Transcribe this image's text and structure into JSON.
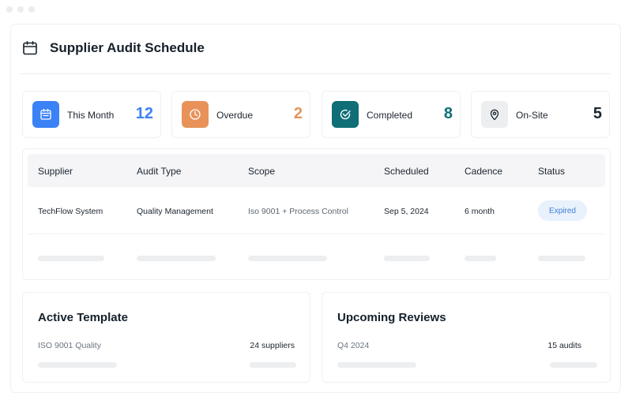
{
  "page": {
    "title": "Supplier Audit Schedule"
  },
  "stats": [
    {
      "label": "This Month",
      "value": "12",
      "color": "#3b82f6",
      "icon": "calendar-icon"
    },
    {
      "label": "Overdue",
      "value": "2",
      "color": "#e8925a",
      "icon": "clock-icon"
    },
    {
      "label": "Completed",
      "value": "8",
      "color": "#0f6e76",
      "icon": "check-circle-icon"
    },
    {
      "label": "On-Site",
      "value": "5",
      "color": "#1b2530",
      "icon": "map-pin-icon"
    }
  ],
  "table": {
    "columns": [
      "Supplier",
      "Audit Type",
      "Scope",
      "Scheduled",
      "Cadence",
      "Status"
    ],
    "rows": [
      {
        "supplier": "TechFlow System",
        "audit_type": "Quality Management",
        "scope": "Iso 9001 + Process Control",
        "scheduled": "Sep 5, 2024",
        "cadence": "6 month",
        "status": "Expired"
      }
    ]
  },
  "active_template": {
    "title": "Active Template",
    "name": "ISO 9001 Quality",
    "count": "24 suppliers"
  },
  "upcoming_reviews": {
    "title": "Upcoming Reviews",
    "period": "Q4 2024",
    "count": "15 audits"
  }
}
